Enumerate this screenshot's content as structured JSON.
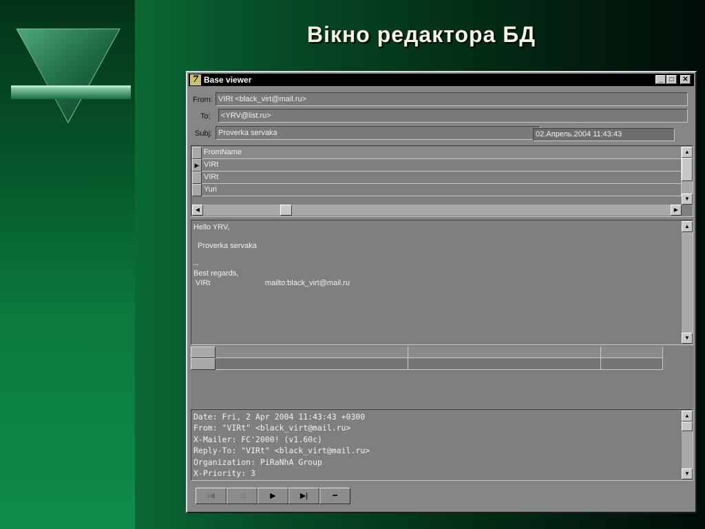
{
  "slide": {
    "title": "Вікно редактора БД"
  },
  "window": {
    "title": "Base viewer",
    "app_icon_glyph": "7",
    "controls": {
      "minimize": "_",
      "maximize": "□",
      "close": "✕"
    }
  },
  "message": {
    "from_label": "From:",
    "from_value": "VIRt <black_virt@mail.ru>",
    "to_label": "To:",
    "to_value": "<YRV@list.ru>",
    "subj_label": "Subj:",
    "subj_value": "Proverka servaka",
    "date_value": "02.Апрель.2004   11:43:43"
  },
  "grid": {
    "column_header": "FromName",
    "rows": [
      "VIRt",
      "VIRt",
      "Yuri"
    ],
    "current_row_marker": "▶"
  },
  "body_text": [
    "Hello YRV,",
    "",
    "  Proverka servaka",
    "",
    "--",
    "Best regards,",
    " VIRt                          mailto:black_virt@mail.ru"
  ],
  "headers_text": [
    "Date: Fri, 2 Apr 2004 11:43:43 +0300",
    "From: \"VIRt\" <black_virt@mail.ru>",
    "X-Mailer: FC'2000! (v1.60c)",
    "Reply-To: \"VIRt\" <black_virt@mail.ru>",
    "Organization: PiRaNhA Group",
    "X-Priority: 3"
  ],
  "navigator": {
    "first": "|◀",
    "prior": "◁",
    "next": "▶",
    "last": "▶|",
    "delete": "━"
  },
  "colors": {
    "background_green": "#0a6a35",
    "title_text": "#f5f5e0",
    "window_gray": "#868686",
    "titlebar": "#000000"
  }
}
